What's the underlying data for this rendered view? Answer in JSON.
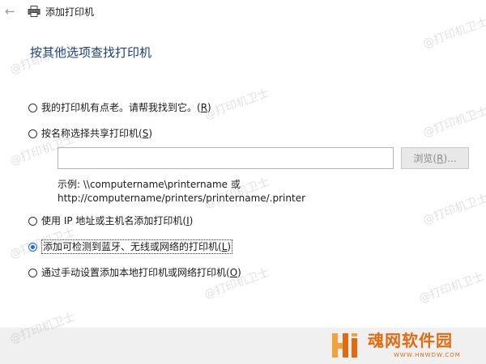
{
  "window": {
    "back_icon": "back-arrow-icon",
    "app_icon": "printer-icon",
    "title": "添加打印机"
  },
  "heading": "按其他选项查找打印机",
  "options": [
    {
      "text": "我的打印机有点老。请帮我找到它。",
      "hotkey": "R",
      "checked": false
    },
    {
      "text": "按名称选择共享打印机",
      "hotkey": "S",
      "checked": false
    },
    {
      "text": "使用 IP 地址或主机名添加打印机",
      "hotkey": "I",
      "checked": false
    },
    {
      "text": "添加可检测到蓝牙、无线或网络的打印机",
      "hotkey": "L",
      "checked": true
    },
    {
      "text": "通过手动设置添加本地打印机或网络打印机",
      "hotkey": "O",
      "checked": false
    }
  ],
  "shared_printer": {
    "input_value": "",
    "browse_text": "浏览",
    "browse_hotkey": "R",
    "example_line1": "示例: \\\\computername\\printername 或",
    "example_line2": "http://computername/printers/printername/.printer"
  },
  "watermark": "@打印机卫士",
  "logo": {
    "name": "魂网软件园",
    "url": "WWW.HNWDW.COM",
    "colors": {
      "primary": "#e06b10",
      "secondary": "#f2a23a"
    }
  },
  "colors": {
    "heading": "#1a3f7a",
    "radio_accent": "#0a64c8",
    "footer_bg": "#f0f0f0"
  }
}
